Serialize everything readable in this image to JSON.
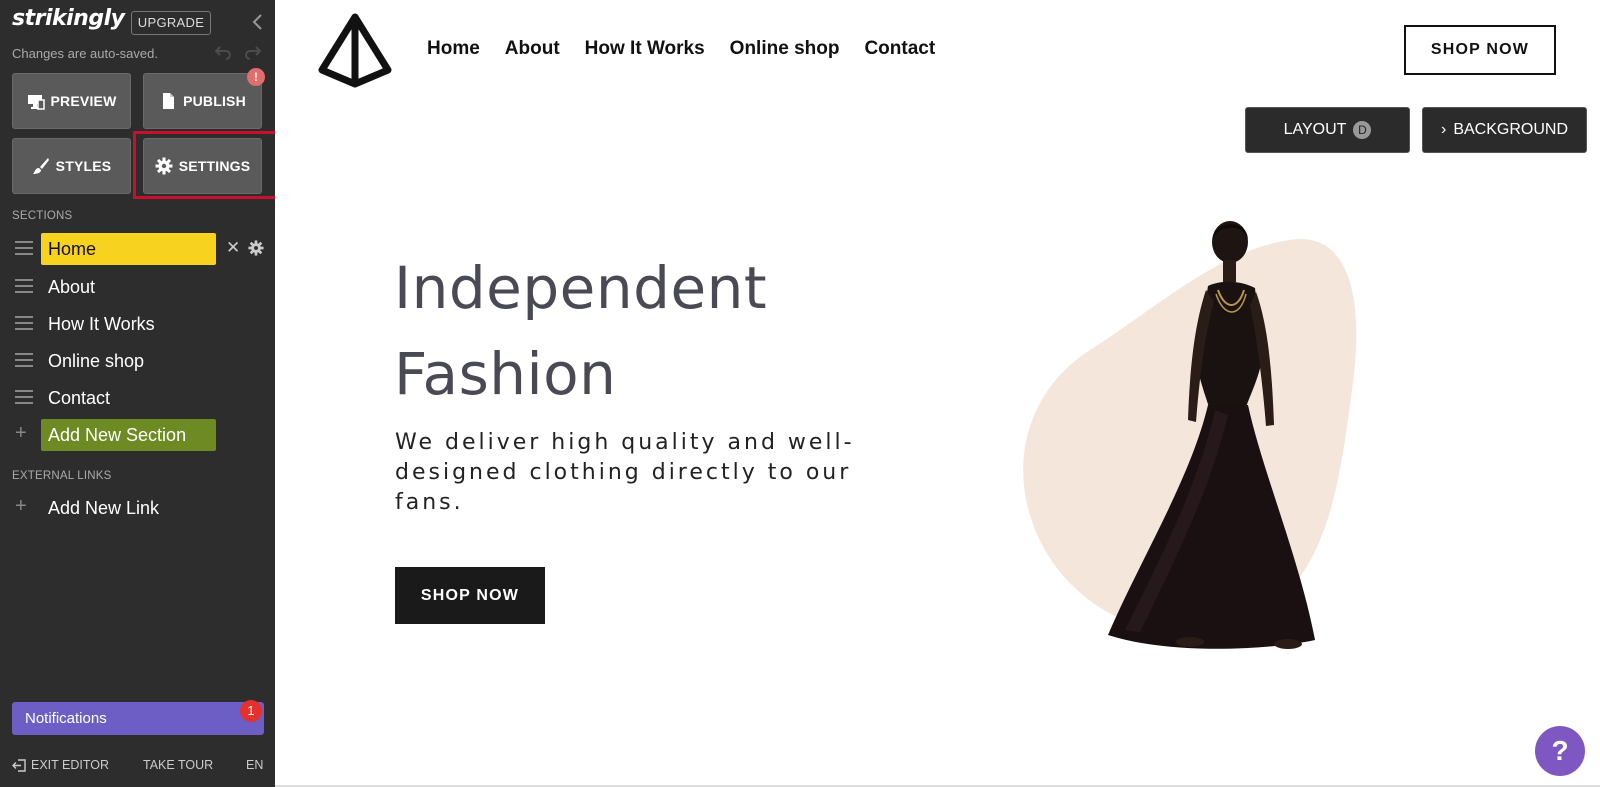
{
  "sidebar": {
    "logo_text": "strikingly",
    "upgrade_label": "UPGRADE",
    "autosave_text": "Changes are auto-saved.",
    "buttons": {
      "preview": "PREVIEW",
      "publish": "PUBLISH",
      "publish_alert": "!",
      "styles": "STYLES",
      "settings": "SETTINGS"
    },
    "sections_heading": "SECTIONS",
    "sections": [
      {
        "label": "Home",
        "active": true
      },
      {
        "label": "About"
      },
      {
        "label": "How It Works"
      },
      {
        "label": "Online shop"
      },
      {
        "label": "Contact"
      }
    ],
    "add_section_label": "Add New Section",
    "external_links_heading": "EXTERNAL LINKS",
    "add_link_label": "Add New Link",
    "notifications_label": "Notifications",
    "notifications_count": "1",
    "footer": {
      "exit": "EXIT EDITOR",
      "tour": "TAKE TOUR",
      "lang": "EN"
    },
    "accent_colors": {
      "active_section": "#f7d21e",
      "add_section": "#6d8b22",
      "notifications": "#6c5ec4",
      "highlight": "#c8102e"
    }
  },
  "site": {
    "nav": [
      "Home",
      "About",
      "How It Works",
      "Online shop",
      "Contact"
    ],
    "shop_now_top": "SHOP NOW",
    "editor_controls": {
      "layout_label": "LAYOUT",
      "layout_badge": "D",
      "background_label": "BACKGROUND"
    },
    "hero": {
      "title_line1": "Independent",
      "title_line2": "Fashion",
      "subtitle": "We deliver high quality and well-designed clothing directly to our fans.",
      "cta": "SHOP NOW"
    },
    "help_label": "?"
  }
}
